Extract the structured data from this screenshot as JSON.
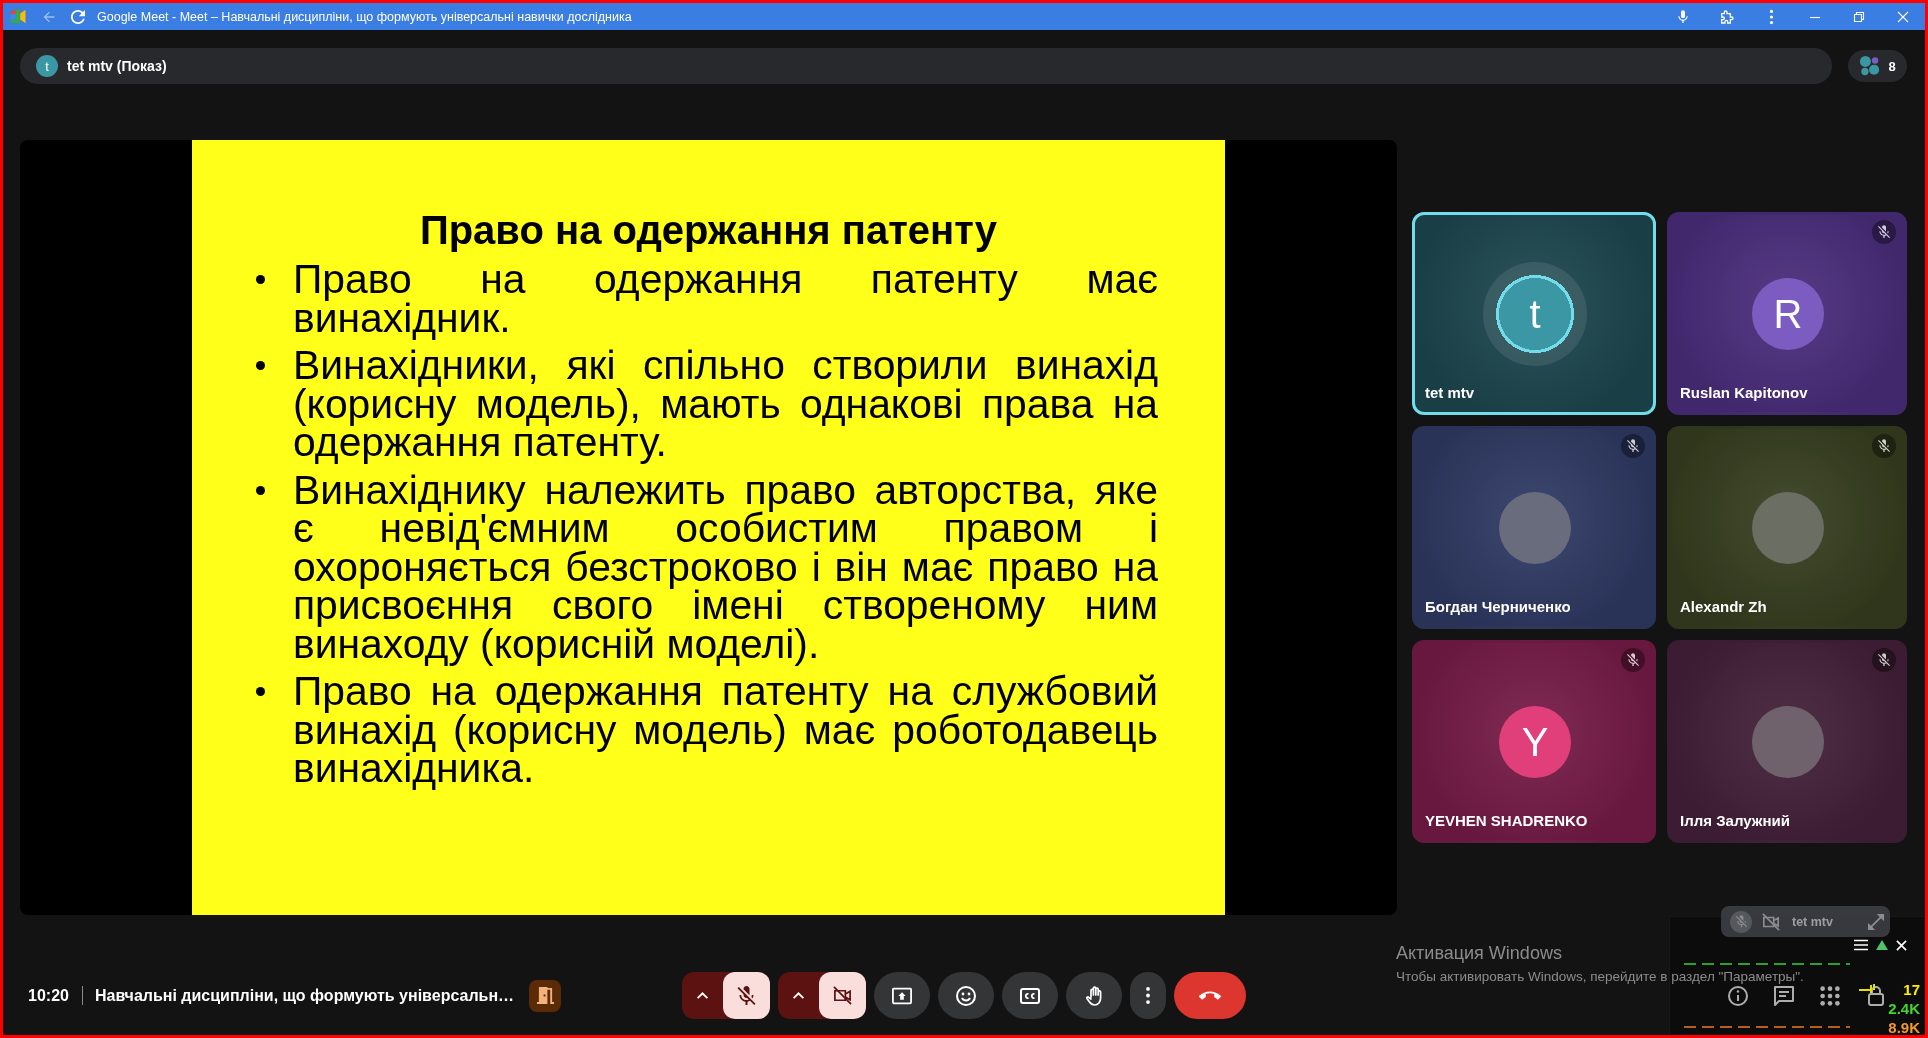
{
  "browser": {
    "title": "Google Meet - Meet – Навчальні дисципліни, що формують універсальні навички дослідника",
    "back_disabled": true
  },
  "presenter_banner": {
    "avatar_letter": "t",
    "label": "tet mtv (Показ)"
  },
  "participants_button": {
    "count": "8"
  },
  "slide": {
    "title": "Право на одержання патенту",
    "bullets": [
      "Право на одержання патенту має винахідник.",
      "Винахідники, які спільно створили винахід (корисну модель), мають однакові права на одержання патенту.",
      "Винахіднику належить право авторства, яке є невід'ємним особистим правом і охороняється безстроково і він має право на присвоєння свого імені створеному ним винаходу (корисній моделі).",
      "Право на одержання патенту на службовий винахід (корисну модель) має роботодавець винахідника."
    ]
  },
  "tiles": [
    {
      "name": "tet mtv",
      "color": "#1d474f",
      "speaking": true,
      "muted": false,
      "avatar": {
        "kind": "letter",
        "letter": "t",
        "color": "#3a97a3"
      }
    },
    {
      "name": "Ruslan Kapitonov",
      "color": "#4a2d7c",
      "speaking": false,
      "muted": true,
      "avatar": {
        "kind": "letter",
        "letter": "R",
        "color": "#7d5cc1"
      }
    },
    {
      "name": "Богдан Черниченко",
      "color": "#2f3a64",
      "speaking": false,
      "muted": true,
      "avatar": {
        "kind": "photo"
      }
    },
    {
      "name": "Alexandr Zh",
      "color": "#363e1f",
      "speaking": false,
      "muted": true,
      "avatar": {
        "kind": "photo"
      }
    },
    {
      "name": "YEVHEN SHADRENKO",
      "color": "#761b47",
      "speaking": false,
      "muted": true,
      "avatar": {
        "kind": "letter",
        "letter": "Y",
        "color": "#e03f79"
      }
    },
    {
      "name": "Ілля Залужний",
      "color": "#432039",
      "speaking": false,
      "muted": true,
      "avatar": {
        "kind": "photo"
      }
    }
  ],
  "self_view": {
    "name": "tet mtv"
  },
  "bottom_bar": {
    "time": "10:20",
    "meeting_title": "Навчальні дисципліни, що формують універсальн…",
    "controls": [
      {
        "kind": "mic",
        "on": false
      },
      {
        "kind": "camera",
        "on": false
      },
      {
        "kind": "present"
      },
      {
        "kind": "reactions"
      },
      {
        "kind": "captions"
      },
      {
        "kind": "raise_hand"
      },
      {
        "kind": "more"
      },
      {
        "kind": "leave"
      }
    ],
    "side_actions": [
      {
        "kind": "info"
      },
      {
        "kind": "chat"
      },
      {
        "kind": "activities"
      },
      {
        "kind": "host_controls"
      }
    ]
  },
  "os_notice": {
    "title": "Активация Windows",
    "text": "Чтобы активировать Windows, перейдите в раздел \"Параметры\"."
  },
  "stats_overlay": {
    "values": [
      {
        "text": "17",
        "color": "#ffee00"
      },
      {
        "text": "2.4K",
        "color": "#44d62c"
      },
      {
        "text": "8.9K",
        "color": "#f39a2b"
      }
    ]
  }
}
